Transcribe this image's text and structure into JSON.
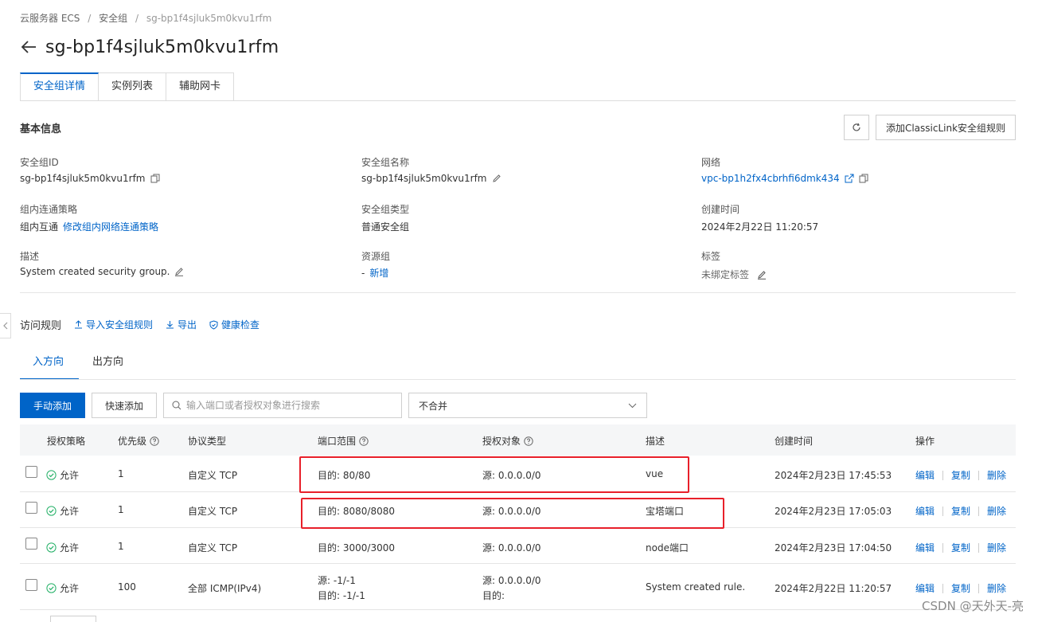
{
  "breadcrumb": {
    "items": [
      "云服务器 ECS",
      "安全组"
    ],
    "current": "sg-bp1f4sjluk5m0kvu1rfm"
  },
  "page": {
    "title": "sg-bp1f4sjluk5m0kvu1rfm"
  },
  "tabs": [
    "安全组详情",
    "实例列表",
    "辅助网卡"
  ],
  "basic": {
    "title": "基本信息",
    "add_classic_label": "添加ClassicLink安全组规则",
    "fields": {
      "sg_id_label": "安全组ID",
      "sg_id_value": "sg-bp1f4sjluk5m0kvu1rfm",
      "sg_name_label": "安全组名称",
      "sg_name_value": "sg-bp1f4sjluk5m0kvu1rfm",
      "network_label": "网络",
      "network_value": "vpc-bp1h2fx4cbrhfi6dmk434",
      "intra_policy_label": "组内连通策略",
      "intra_policy_value": "组内互通",
      "intra_policy_link": "修改组内网络连通策略",
      "sg_type_label": "安全组类型",
      "sg_type_value": "普通安全组",
      "created_label": "创建时间",
      "created_value": "2024年2月22日 11:20:57",
      "desc_label": "描述",
      "desc_value": "System created security group.",
      "resource_group_label": "资源组",
      "resource_group_value": "-",
      "resource_group_link": "新增",
      "tags_label": "标签",
      "tags_value": "未绑定标签"
    }
  },
  "rules": {
    "title": "访问规则",
    "import_label": "导入安全组规则",
    "export_label": "导出",
    "health_label": "健康检查",
    "direction_tabs": [
      "入方向",
      "出方向"
    ],
    "manual_add": "手动添加",
    "quick_add": "快速添加",
    "search_placeholder": "输入端口或者授权对象进行搜索",
    "merge_select": "不合并",
    "headers": [
      "授权策略",
      "优先级",
      "协议类型",
      "端口范围",
      "授权对象",
      "描述",
      "创建时间",
      "操作"
    ],
    "rows": [
      {
        "policy": "允许",
        "priority": "1",
        "protocol": "自定义 TCP",
        "port1": "目的: 80/80",
        "port2": "",
        "source1": "源: 0.0.0.0/0",
        "source2": "",
        "desc": "vue",
        "created": "2024年2月23日 17:45:53"
      },
      {
        "policy": "允许",
        "priority": "1",
        "protocol": "自定义 TCP",
        "port1": "目的: 8080/8080",
        "port2": "",
        "source1": "源: 0.0.0.0/0",
        "source2": "",
        "desc": "宝塔端口",
        "created": "2024年2月23日 17:05:03"
      },
      {
        "policy": "允许",
        "priority": "1",
        "protocol": "自定义 TCP",
        "port1": "目的: 3000/3000",
        "port2": "",
        "source1": "源: 0.0.0.0/0",
        "source2": "",
        "desc": "node端口",
        "created": "2024年2月23日 17:04:50"
      },
      {
        "policy": "允许",
        "priority": "100",
        "protocol": "全部 ICMP(IPv4)",
        "port1": "源: -1/-1",
        "port2": "目的: -1/-1",
        "source1": "源: 0.0.0.0/0",
        "source2": "目的:",
        "desc": "System created rule.",
        "created": "2024年2月22日 11:20:57"
      }
    ],
    "ops": [
      "编辑",
      "复制",
      "删除"
    ]
  },
  "watermark": "CSDN @天外天-亮",
  "colors": {
    "accent": "#0064c8",
    "success": "#23b066",
    "highlight": "#e8202a"
  }
}
